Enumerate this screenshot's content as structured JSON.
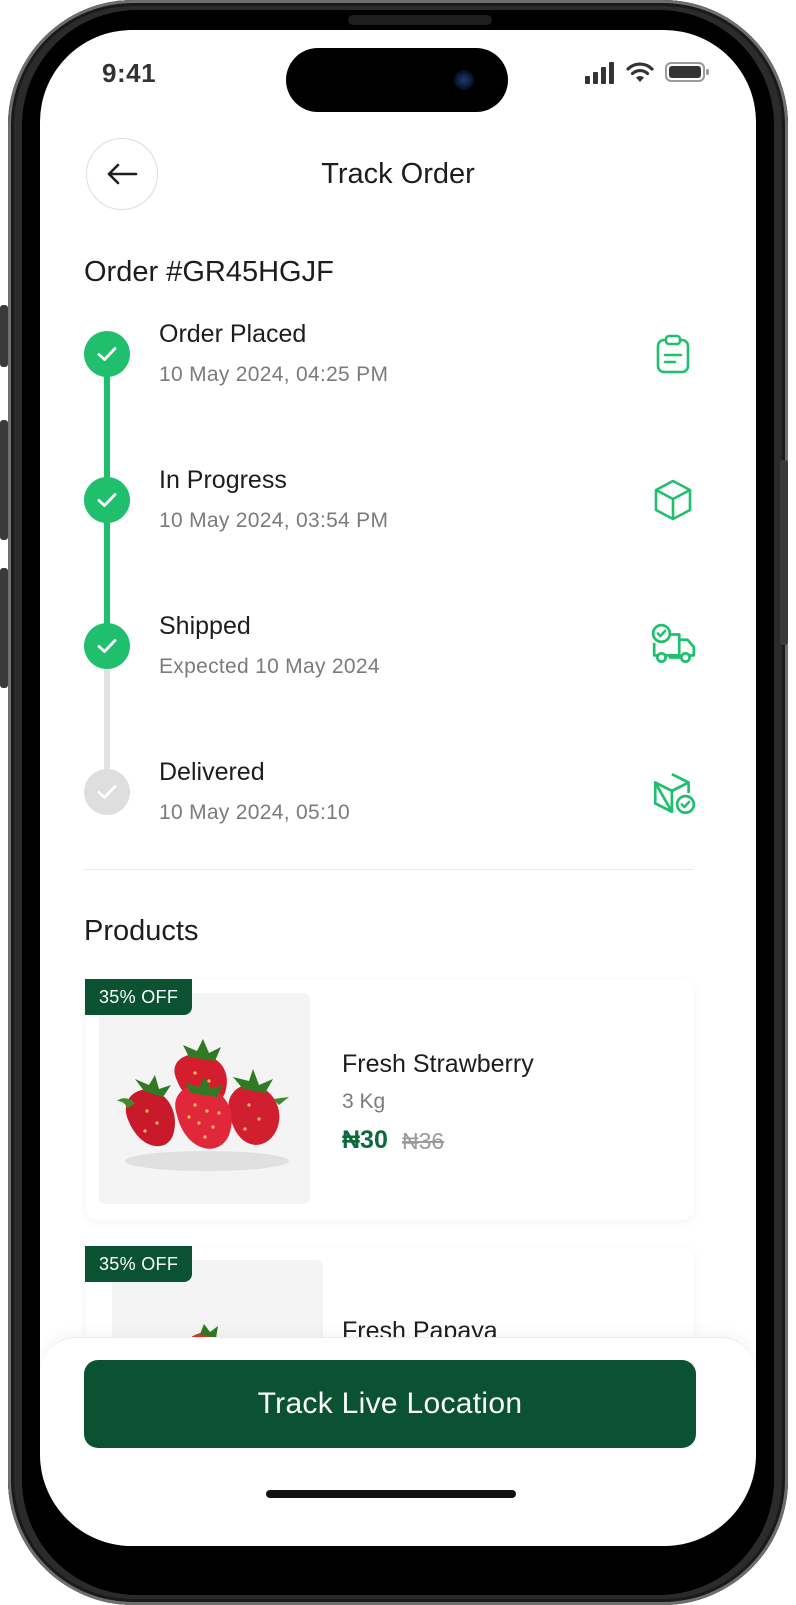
{
  "status_bar": {
    "time": "9:41"
  },
  "header": {
    "title": "Track Order"
  },
  "order": {
    "id_label": "Order #GR45HGJF"
  },
  "timeline": {
    "steps": [
      {
        "title": "Order Placed",
        "date": "10 May 2024, 04:25 PM",
        "completed": true,
        "icon": "clipboard-icon"
      },
      {
        "title": "In Progress",
        "date": "10 May 2024, 03:54 PM",
        "completed": true,
        "icon": "box-icon"
      },
      {
        "title": "Shipped",
        "date": "Expected 10 May 2024",
        "completed": true,
        "icon": "delivery-truck-icon"
      },
      {
        "title": "Delivered",
        "date": "10 May 2024, 05:10",
        "completed": false,
        "icon": "box-check-icon"
      }
    ]
  },
  "products": {
    "section_title": "Products",
    "items": [
      {
        "badge": "35% OFF",
        "name": "Fresh Strawberry",
        "weight": "3 Kg",
        "price": "₦30",
        "old_price": "₦36"
      },
      {
        "badge": "35% OFF",
        "name": "Fresh Papaya"
      }
    ]
  },
  "footer": {
    "button_label": "Track Live Location"
  },
  "colors": {
    "primary": "#0b5233",
    "accent": "#1fbf6e",
    "price": "#0b6a3c",
    "inactive": "#dedede"
  }
}
